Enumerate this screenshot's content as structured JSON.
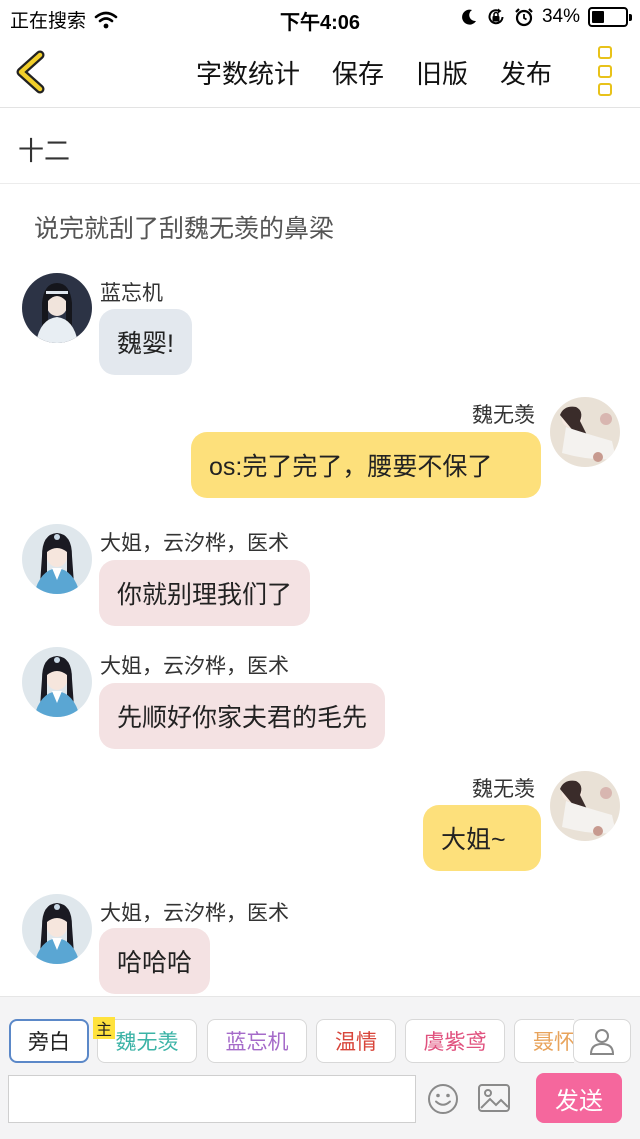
{
  "status_bar": {
    "carrier": "正在搜索",
    "time": "下午4:06",
    "battery_percent": "34%",
    "battery_level": 0.34
  },
  "nav": {
    "actions": [
      "字数统计",
      "保存",
      "旧版",
      "发布"
    ]
  },
  "chapter": {
    "title": "十二"
  },
  "narration": "说完就刮了刮魏无羡的鼻梁",
  "messages": [
    {
      "side": "left",
      "speaker": "蓝忘机",
      "text": "魏婴!",
      "color": "gray",
      "avatar": "lanwangji"
    },
    {
      "side": "right",
      "speaker": "魏无羡",
      "text": "os:完了完了，腰要不保了",
      "color": "yellow",
      "avatar": "weiwuxian"
    },
    {
      "side": "left",
      "speaker": "大姐，云汐桦，医术",
      "text": "你就别理我们了",
      "color": "pink",
      "avatar": "dajie"
    },
    {
      "side": "left",
      "speaker": "大姐，云汐桦，医术",
      "text": "先顺好你家夫君的毛先",
      "color": "pink",
      "avatar": "dajie"
    },
    {
      "side": "right",
      "speaker": "魏无羡",
      "text": "大姐~",
      "color": "yellow",
      "avatar": "weiwuxian"
    },
    {
      "side": "left",
      "speaker": "大姐，云汐桦，医术",
      "text": "哈哈哈",
      "color": "pink",
      "avatar": "dajie"
    }
  ],
  "roles": [
    {
      "label": "旁白",
      "color": "#222222",
      "active": true
    },
    {
      "label": "魏无羡",
      "color": "#3bb3a6",
      "active": false
    },
    {
      "label": "蓝忘机",
      "color": "#a56bc9",
      "active": false
    },
    {
      "label": "温情",
      "color": "#d8453a",
      "active": false
    },
    {
      "label": "虞紫鸢",
      "color": "#e0517e",
      "active": false
    },
    {
      "label": "聂怀",
      "color": "#e8a35b",
      "active": false
    }
  ],
  "host_badge": "主",
  "composer": {
    "send_label": "发送",
    "placeholder": ""
  },
  "colors": {
    "gray_bubble": "#e3e8ee",
    "yellow_bubble": "#fde07b",
    "pink_bubble": "#f4e2e3",
    "send_button": "#f5679d",
    "accent": "#e8c21a"
  },
  "icons": [
    "back-chevron-icon",
    "more-icon",
    "wifi-icon",
    "moon-icon",
    "lock-rotation-icon",
    "alarm-icon",
    "battery-icon",
    "emoji-icon",
    "image-icon",
    "user-icon"
  ]
}
